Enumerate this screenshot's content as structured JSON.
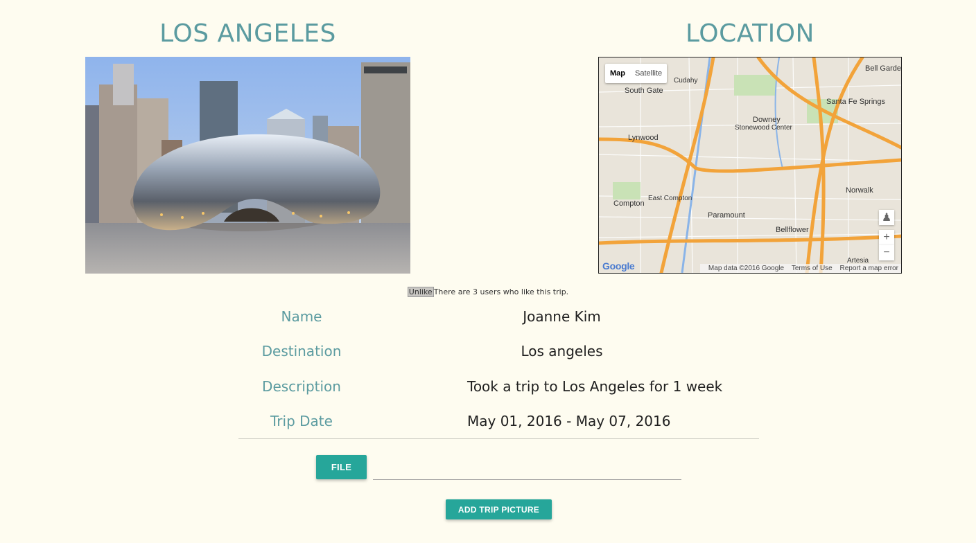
{
  "trip": {
    "title": "LOS ANGELES",
    "location_title": "LOCATION"
  },
  "map": {
    "type_map": "Map",
    "type_satellite": "Satellite",
    "zoom_in": "+",
    "zoom_out": "−",
    "logo": "Google",
    "attribution": "Map data ©2016 Google",
    "terms": "Terms of Use",
    "report": "Report a map error",
    "places": [
      "Bell Gardens",
      "Cudahy",
      "South Gate",
      "Santa Fe Springs",
      "Downey",
      "Stonewood Center",
      "Lynwood",
      "Norwalk",
      "Compton",
      "East Compton",
      "Paramount",
      "Bellflower",
      "Artesia"
    ],
    "colors": {
      "land": "#e9e4da",
      "highway": "#f2a33a",
      "water": "#8ab4e8",
      "park": "#c9e2b6"
    }
  },
  "likes": {
    "button": "Unlike",
    "text": "There are 3 users who like this trip."
  },
  "details": [
    {
      "label": "Name",
      "value": "Joanne Kim"
    },
    {
      "label": "Destination",
      "value": "Los angeles"
    },
    {
      "label": "Description",
      "value": "Took a trip to Los Angeles for 1 week"
    },
    {
      "label": "Trip Date",
      "value": "May 01, 2016 - May 07, 2016"
    }
  ],
  "upload": {
    "file_button": "FILE",
    "file_path": "",
    "add_button": "ADD TRIP PICTURE"
  },
  "colors": {
    "accent": "#26a69a",
    "heading": "#5b9ba0",
    "background": "#fefcf0"
  }
}
